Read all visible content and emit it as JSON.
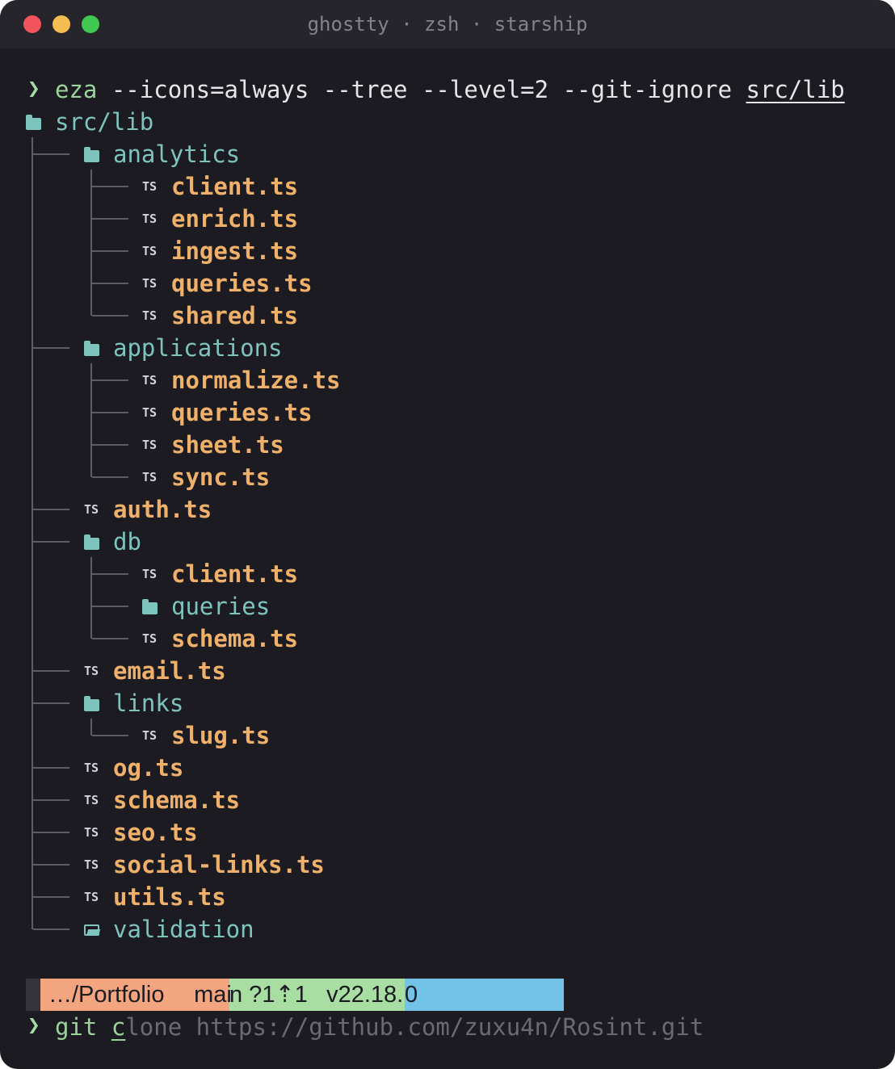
{
  "window": {
    "title": "ghostty · zsh · starship"
  },
  "prompt_symbol": "❯",
  "command": {
    "name": "eza",
    "args": " --icons=always --tree --level=2 --git-ignore ",
    "path": "src/lib"
  },
  "tree": {
    "root": "src/lib",
    "entries": [
      {
        "name": "analytics",
        "type": "dir"
      },
      {
        "name": "client.ts",
        "type": "ts"
      },
      {
        "name": "enrich.ts",
        "type": "ts"
      },
      {
        "name": "ingest.ts",
        "type": "ts"
      },
      {
        "name": "queries.ts",
        "type": "ts"
      },
      {
        "name": "shared.ts",
        "type": "ts"
      },
      {
        "name": "applications",
        "type": "dir"
      },
      {
        "name": "normalize.ts",
        "type": "ts"
      },
      {
        "name": "queries.ts",
        "type": "ts"
      },
      {
        "name": "sheet.ts",
        "type": "ts"
      },
      {
        "name": "sync.ts",
        "type": "ts"
      },
      {
        "name": "auth.ts",
        "type": "ts"
      },
      {
        "name": "db",
        "type": "dir"
      },
      {
        "name": "client.ts",
        "type": "ts"
      },
      {
        "name": "queries",
        "type": "dir"
      },
      {
        "name": "schema.ts",
        "type": "ts"
      },
      {
        "name": "email.ts",
        "type": "ts"
      },
      {
        "name": "links",
        "type": "dir"
      },
      {
        "name": "slug.ts",
        "type": "ts"
      },
      {
        "name": "og.ts",
        "type": "ts"
      },
      {
        "name": "schema.ts",
        "type": "ts"
      },
      {
        "name": "seo.ts",
        "type": "ts"
      },
      {
        "name": "social-links.ts",
        "type": "ts"
      },
      {
        "name": "utils.ts",
        "type": "ts"
      },
      {
        "name": "validation",
        "type": "dir-open"
      }
    ],
    "ts_icon_text": "TS"
  },
  "status_bar": {
    "directory": "…/Portfolio",
    "branch_lead": "  mai",
    "branch_tail": "n ?1⇡1",
    "node_lead": "  v22.18.",
    "node_tail": "0"
  },
  "next_command": {
    "typed": "git ",
    "cursor_char": "c",
    "suggestion": "lone https://github.com/zuxu4n/Rosint.git"
  },
  "colors": {
    "background": "#1c1b22",
    "directory": "#7ec4be",
    "ts_file": "#efb06a",
    "prompt": "#a6dba6",
    "status_dir": "#f2a57e",
    "status_git": "#a8dea2",
    "status_node": "#73c2e8"
  }
}
